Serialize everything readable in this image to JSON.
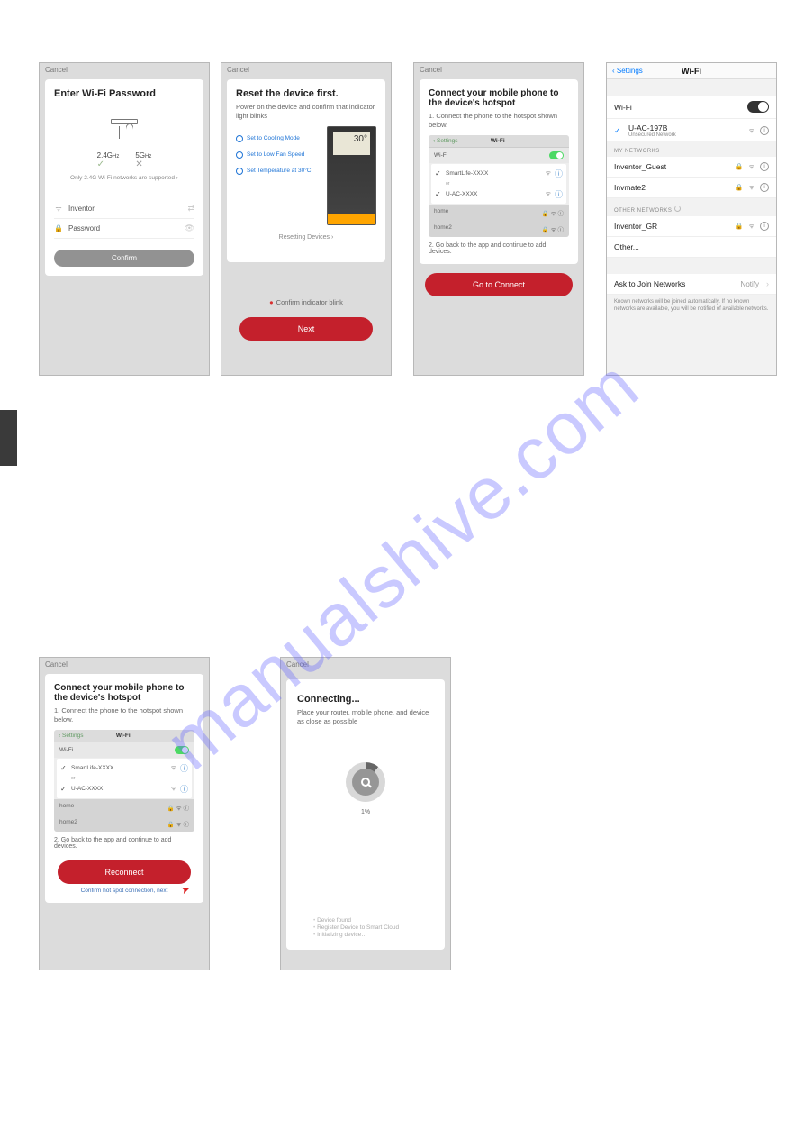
{
  "watermark": "manualshive.com",
  "screen1": {
    "cancel": "Cancel",
    "title": "Enter Wi-Fi Password",
    "freq1": "2.4G",
    "hz1": "Hz",
    "freq2": "5G",
    "hz2": "Hz",
    "note": "Only 2.4G Wi-Fi networks are supported ›",
    "ssid_label": "Inventor",
    "pwd_label": "Password",
    "confirm": "Confirm"
  },
  "screen2": {
    "cancel": "Cancel",
    "title": "Reset the device first.",
    "sub": "Power on the device and confirm that indicator light blinks",
    "opt1": "Set to Cooling Mode",
    "opt2": "Set to Low Fan Speed",
    "opt3": "Set Temperature at 30°C",
    "remote_temp": "30",
    "reset_link": "Resetting Devices ›",
    "confirm_blink": "Confirm indicator blink",
    "next": "Next"
  },
  "screen3": {
    "cancel": "Cancel",
    "title": "Connect your mobile phone to the device's hotspot",
    "step1": "1. Connect the phone to the hotspot shown below.",
    "mini_back": "Settings",
    "mini_title": "Wi-Fi",
    "wifi_label": "Wi-Fi",
    "net1": "SmartLife-XXXX",
    "or": "or",
    "net2": "U-AC-XXXX",
    "home1": "home",
    "home2": "home2",
    "step2": "2. Go back to the app and continue to add devices.",
    "go": "Go to Connect"
  },
  "screen4": {
    "back": "Settings",
    "title": "Wi-Fi",
    "wifi": "Wi-Fi",
    "current_net": "U-AC-197B",
    "current_sub": "Unsecured Network",
    "my_networks": "MY NETWORKS",
    "net1": "Inventor_Guest",
    "net2": "Invmate2",
    "other_networks": "OTHER NETWORKS",
    "net3": "Inventor_GR",
    "other": "Other...",
    "ask": "Ask to Join Networks",
    "notify": "Notify",
    "note": "Known networks will be joined automatically. If no known networks are available, you will be notified of available networks."
  },
  "screen5": {
    "cancel": "Cancel",
    "title": "Connect your mobile phone to the device's hotspot",
    "step1": "1. Connect the phone to the hotspot shown below.",
    "mini_back": "Settings",
    "mini_title": "Wi-Fi",
    "wifi_label": "Wi-Fi",
    "net1": "SmartLife-XXXX",
    "or": "or",
    "net2": "U-AC-XXXX",
    "home1": "home",
    "home2": "home2",
    "step2": "2. Go back to the app and continue to add devices.",
    "reconnect": "Reconnect",
    "confirm_link": "Confirm hot spot connection, next"
  },
  "screen6": {
    "cancel": "Cancel",
    "title": "Connecting...",
    "sub": "Place your router, mobile phone, and device as close as possible",
    "pct": "1%",
    "s1": "Device found",
    "s2": "Register Device to Smart Cloud",
    "s3": "Initializing device…"
  }
}
